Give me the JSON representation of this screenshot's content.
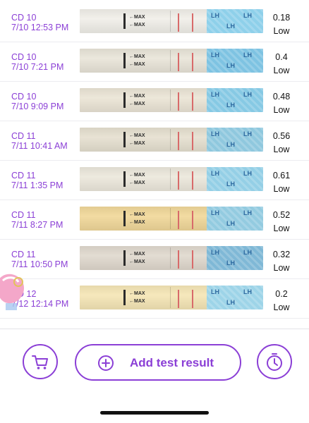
{
  "entries": [
    {
      "cd": "CD 10",
      "datetime": "7/10 12:53 PM",
      "value": "0.18",
      "level": "Low",
      "paper": "#f1efe9",
      "brand": "#8ed0ea"
    },
    {
      "cd": "CD 10",
      "datetime": "7/10 7:21 PM",
      "value": "0.4",
      "level": "Low",
      "paper": "#e9e5d9",
      "brand": "#7ec3e2"
    },
    {
      "cd": "CD 10",
      "datetime": "7/10 9:09 PM",
      "value": "0.48",
      "level": "Low",
      "paper": "#ebe5d6",
      "brand": "#86c9e4"
    },
    {
      "cd": "CD 11",
      "datetime": "7/11 10:41 AM",
      "value": "0.56",
      "level": "Low",
      "paper": "#e6e0d0",
      "brand": "#8fc8de"
    },
    {
      "cd": "CD 11",
      "datetime": "7/11 1:35 PM",
      "value": "0.61",
      "level": "Low",
      "paper": "#ece8dc",
      "brand": "#94cfe6"
    },
    {
      "cd": "CD 11",
      "datetime": "7/11 8:27 PM",
      "value": "0.52",
      "level": "Low",
      "paper": "#f1d89a",
      "brand": "#93cbe0"
    },
    {
      "cd": "CD 11",
      "datetime": "7/11 10:50 PM",
      "value": "0.32",
      "level": "Low",
      "paper": "#e0d9ce",
      "brand": "#7fb8d6"
    },
    {
      "cd": "CD 12",
      "datetime": "7/12 12:14 PM",
      "value": "0.2",
      "level": "Low",
      "paper": "#f5e6b6",
      "brand": "#9dd4e8"
    }
  ],
  "strip_labels": {
    "max": "MAX",
    "lh": "LH"
  },
  "actions": {
    "add_label": "Add test result",
    "cart_icon": "shopping-cart-icon",
    "timer_icon": "timer-icon",
    "plus_icon": "plus-circle-icon"
  },
  "colors": {
    "accent": "#8b3fd6",
    "test_line": "#d86a6a"
  }
}
